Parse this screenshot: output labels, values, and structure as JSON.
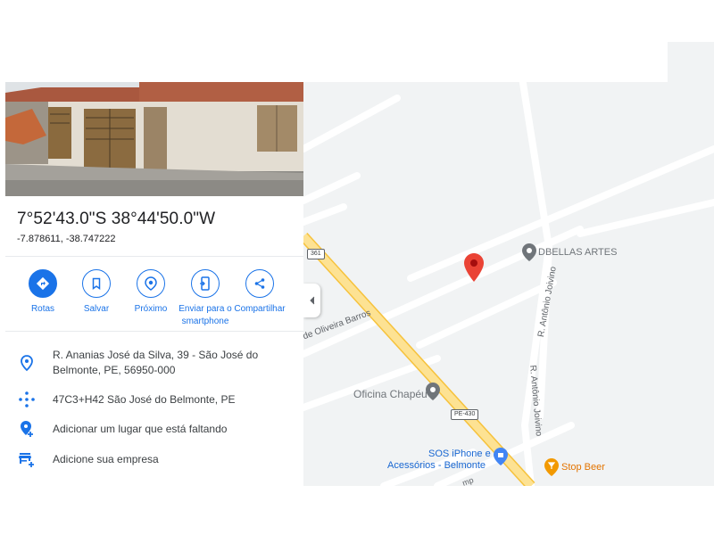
{
  "place": {
    "coords_dms": "7°52'43.0\"S 38°44'50.0\"W",
    "coords_decimal": "-7.878611, -38.747222"
  },
  "actions": [
    {
      "label": "Rotas",
      "icon": "directions-icon"
    },
    {
      "label": "Salvar",
      "icon": "bookmark-icon"
    },
    {
      "label": "Próximo",
      "icon": "nearby-icon"
    },
    {
      "label": "Enviar para o smartphone",
      "icon": "send-to-phone-icon"
    },
    {
      "label": "Compartilhar",
      "icon": "share-icon"
    }
  ],
  "info": {
    "address": "R. Ananias José da Silva, 39 - São José do Belmonte, PE, 56950-000",
    "plus_code": "47C3+H42 São José do Belmonte, PE",
    "add_place": "Adicionar um lugar que está faltando",
    "add_business": "Adicione sua empresa"
  },
  "map": {
    "labels": {
      "dbellas": "DBELLAS ARTES",
      "oficina": "Oficina Chapéu",
      "sos_line1": "SOS iPhone e",
      "sos_line2": "Acessórios - Belmonte",
      "stop_beer": "Stop Beer",
      "street_oliveira": "de Oliveira Barros",
      "street_antonio1": "R. Antônio Joivino",
      "street_antonio2": "R. Antônio Joivino",
      "street_bottom": "mp"
    },
    "shields": {
      "route_361": "361",
      "route_pe430": "PE-430"
    }
  },
  "colors": {
    "accent": "#1a73e8",
    "marker": "#ea4335",
    "poi_gray": "#70757a",
    "poi_food": "#f29900",
    "highway": "#fde293",
    "highway_edge": "#f6c23c",
    "map_bg": "#f1f3f4"
  }
}
